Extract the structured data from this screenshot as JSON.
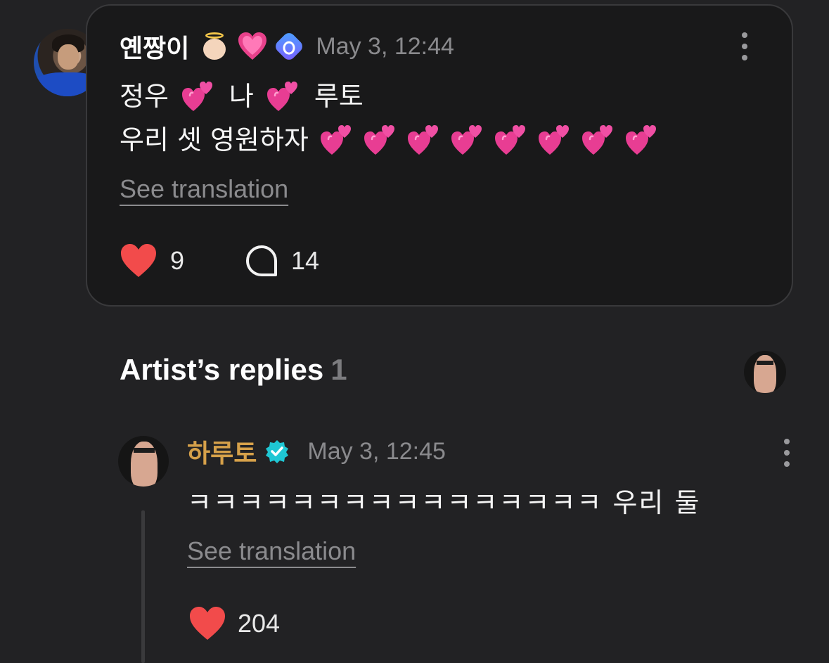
{
  "post": {
    "author": "옌짱이",
    "emojis": [
      "angel-emoji",
      "pink-heart-emoji"
    ],
    "badge_icon": "membership-check-icon",
    "timestamp": "May 3, 12:44",
    "line1_parts": [
      "정우",
      "나",
      "루토"
    ],
    "line2_text": "우리 셋 영원하자",
    "line2_heart_count": 8,
    "see_translation": "See translation",
    "likes": "9",
    "comments": "14"
  },
  "artist_replies": {
    "title": "Artist’s replies",
    "count": "1"
  },
  "reply": {
    "author": "하루토",
    "timestamp": "May 3, 12:45",
    "text": "ㅋㅋㅋㅋㅋㅋㅋㅋㅋㅋㅋㅋㅋㅋㅋㅋ 우리 둘",
    "see_translation": "See translation",
    "likes": "204"
  },
  "colors": {
    "background": "#222224",
    "card": "#19191a",
    "like_red": "#f24b4b",
    "artist_name": "#d6a14a",
    "verified_teal": "#1fc7d4",
    "muted_text": "#8a8a8d"
  }
}
